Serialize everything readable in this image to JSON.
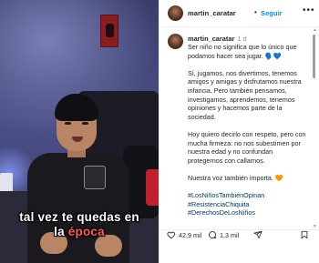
{
  "video": {
    "caption_line1": "tal vez te quedas en",
    "caption_line2_prefix": "la ",
    "caption_line2_highlight": "época"
  },
  "post": {
    "username": "martin_caratar",
    "follow_label": "Seguir",
    "more_label": "•••"
  },
  "comment": {
    "username": "martin_caratar",
    "time": "1 d",
    "paragraphs": [
      "Ser niño no significa que lo único que podamos hacer sea jugar. 🗣️💙",
      "Sí, jugamos, nos divertimos, tenemos amigos y amigas y disfrutamos nuestra infancia. Pero también pensamos, investigamos, aprendemos, tenemos opiniones y hacemos parte de la sociedad.",
      "Hoy quiero decirlo con respeto, pero con mucha firmeza: no nos subestimen por nuestra edad y no confundan protegernos con callarnos.",
      "Nuestra voz también importa. 🧡"
    ],
    "hashtags": [
      "#LosNiñosTambiénOpinan",
      "#ResistenciaChiquita",
      "#DerechosDeLosNiños"
    ]
  },
  "actions": {
    "likes": "42,9 mil",
    "comments": "1,3 mil",
    "icons": [
      "heart-icon",
      "comment-icon",
      "share-icon",
      "bookmark-icon"
    ]
  },
  "colors": {
    "link": "#0095f6",
    "hashtag": "#00376b",
    "text": "#262626",
    "caption_highlight": "#ff5a5a"
  }
}
